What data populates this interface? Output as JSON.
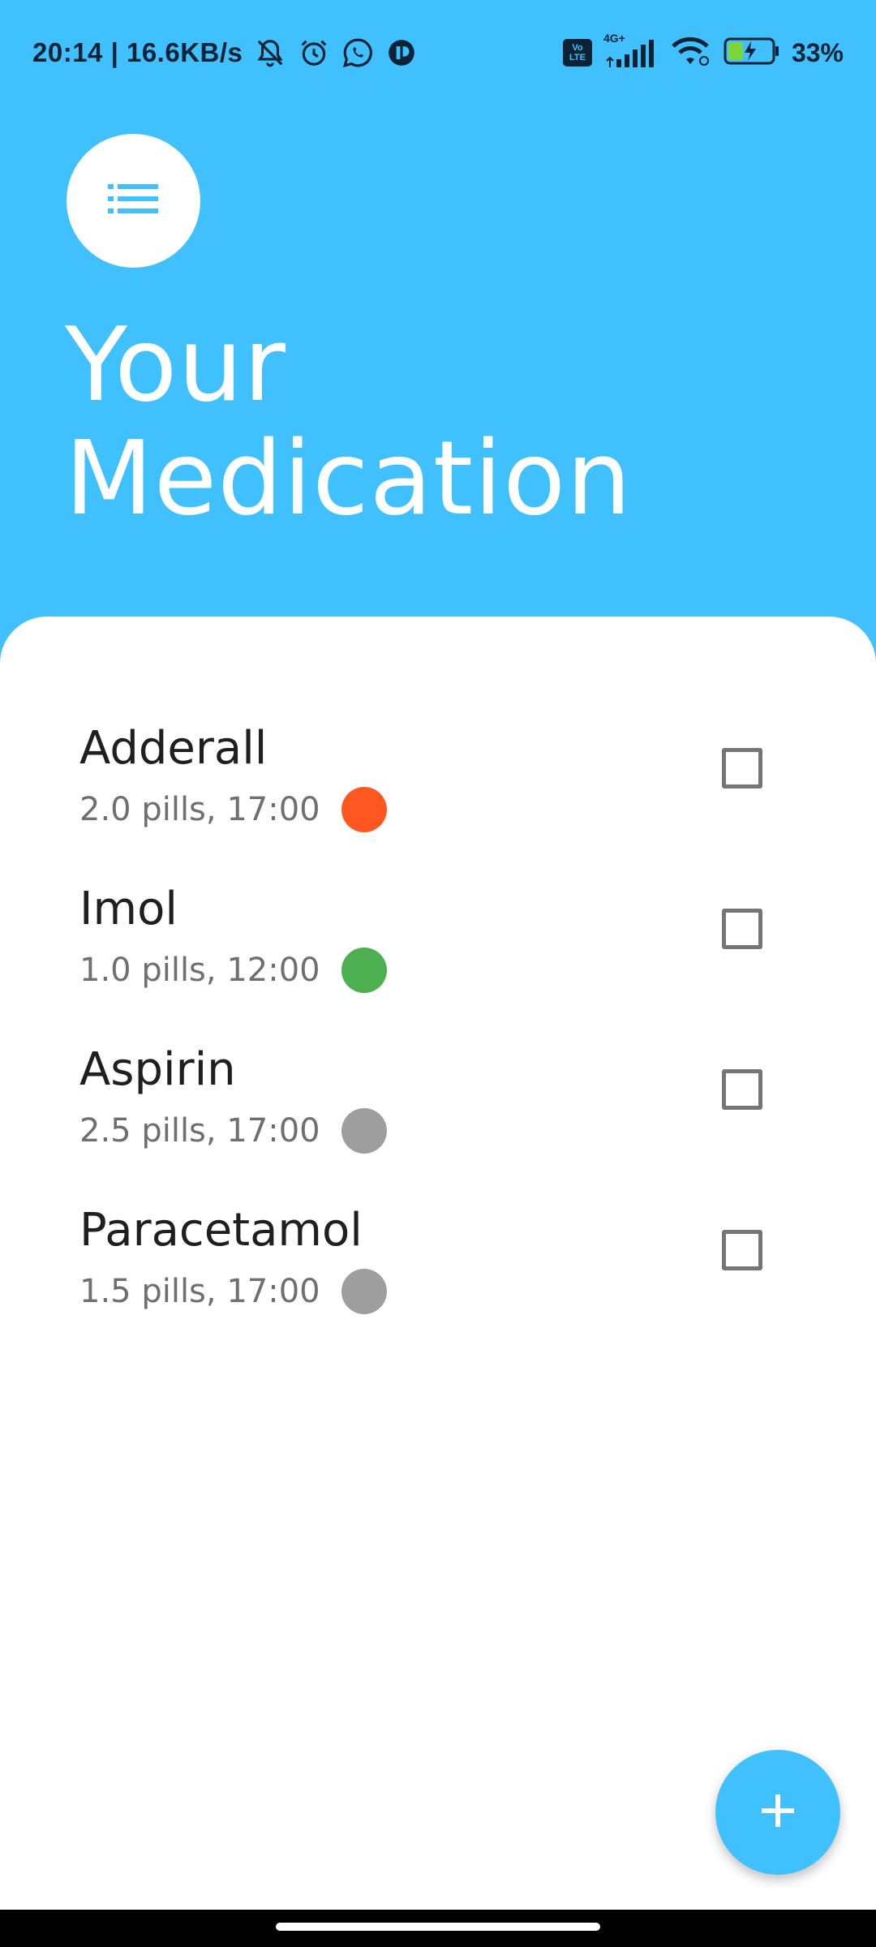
{
  "status_bar": {
    "time_speed": "20:14 | 16.6KB/s",
    "network_label": "4G+",
    "volte_top": "Vo",
    "volte_bottom": "LTE",
    "battery_percent": "33%",
    "icons": [
      "bell-off-icon",
      "alarm-icon",
      "whatsapp-icon",
      "app-icon",
      "volte-icon",
      "signal-icon",
      "wifi-icon",
      "battery-charging-icon"
    ]
  },
  "header": {
    "menu_icon": "list-icon",
    "title_line1": "Your",
    "title_line2": "Medication"
  },
  "medications": [
    {
      "name": "Adderall",
      "detail": "2.0 pills, 17:00",
      "color": "#FF5722",
      "checked": false
    },
    {
      "name": "Imol",
      "detail": "1.0 pills, 12:00",
      "color": "#4CAF50",
      "checked": false
    },
    {
      "name": "Aspirin",
      "detail": "2.5 pills, 17:00",
      "color": "#9E9E9E",
      "checked": false
    },
    {
      "name": "Paracetamol",
      "detail": "1.5 pills, 17:00",
      "color": "#9E9E9E",
      "checked": false
    }
  ],
  "fab": {
    "icon": "plus-icon"
  },
  "colors": {
    "accent": "#40C1FE",
    "text_dark": "#1f1f1f",
    "text_secondary": "#6f6f6f"
  }
}
